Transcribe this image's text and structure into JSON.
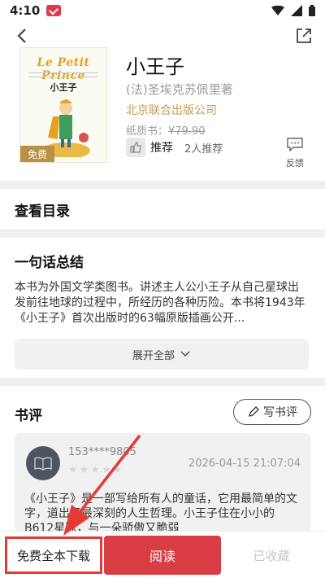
{
  "status_bar": {
    "time": "4:10"
  },
  "book": {
    "cover_title": "Le Petit Prince",
    "cover_cn_title": "小王子",
    "free_tag": "免费",
    "title": "小王子",
    "author": "(法)圣埃克苏佩里著",
    "publisher": "北京联合出版公司",
    "price_label": "纸质书：",
    "price_value": "¥79.90",
    "recommend_label": "推荐",
    "recommend_count": "2人推荐",
    "feedback_label": "反馈"
  },
  "toc": {
    "title": "查看目录"
  },
  "summary": {
    "title": "一句话总结",
    "text": "本书为外国文学类图书。讲述主人公小王子从自己星球出发前往地球的过程中，所经历的各种历险。本书将1943年《小王子》首次出版时的63幅原版插画公开...",
    "expand_label": "展开全部"
  },
  "reviews": {
    "title": "书评",
    "write_label": "写书评",
    "items": [
      {
        "user": "153****9805",
        "date": "2026-04-15 21:07:04",
        "stars": "★★★★★",
        "text": "《小王子》是一部写给所有人的童话，它用最简单的文字，道出了最深刻的人生哲理。小王子住在小小的B612星球，与一朵骄傲又脆弱"
      }
    ]
  },
  "bottom_bar": {
    "download_label": "免费全本下载",
    "read_label": "阅读",
    "fav_label": "已收藏"
  },
  "colors": {
    "accent": "#d93d44",
    "highlight": "#e53935",
    "publisher": "#c49a56"
  }
}
